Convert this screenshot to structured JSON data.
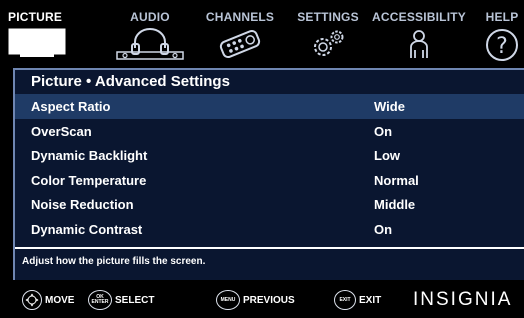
{
  "tabs": [
    {
      "label": "PICTURE",
      "icon": "tv-icon",
      "active": true
    },
    {
      "label": "AUDIO",
      "icon": "headphones-icon",
      "active": false
    },
    {
      "label": "CHANNELS",
      "icon": "remote-icon",
      "active": false
    },
    {
      "label": "SETTINGS",
      "icon": "gears-icon",
      "active": false
    },
    {
      "label": "ACCESSIBILITY",
      "icon": "person-icon",
      "active": false
    },
    {
      "label": "HELP",
      "icon": "help-icon",
      "active": false
    }
  ],
  "panel": {
    "title": "Picture • Advanced Settings",
    "rows": [
      {
        "label": "Aspect Ratio",
        "value": "Wide",
        "selected": true
      },
      {
        "label": "OverScan",
        "value": "On",
        "selected": false
      },
      {
        "label": "Dynamic Backlight",
        "value": "Low",
        "selected": false
      },
      {
        "label": "Color Temperature",
        "value": "Normal",
        "selected": false
      },
      {
        "label": "Noise Reduction",
        "value": "Middle",
        "selected": false
      },
      {
        "label": "Dynamic Contrast",
        "value": "On",
        "selected": false
      }
    ],
    "hint": "Adjust how the picture fills the screen."
  },
  "footer": {
    "keys": [
      {
        "icon": "dpad-icon",
        "key_text": "",
        "label": "MOVE"
      },
      {
        "icon": "ok-enter-icon",
        "key_text": "OK ENTER",
        "label": "SELECT"
      },
      {
        "icon": "menu-icon",
        "key_text": "MENU",
        "label": "PREVIOUS"
      },
      {
        "icon": "exit-icon",
        "key_text": "EXIT",
        "label": "EXIT"
      }
    ],
    "brand": "INSIGNIA"
  },
  "colors": {
    "panel_bg": "#0a1630",
    "selected_row": "#1f3b66",
    "panel_border": "#6f86b2",
    "inactive_tab_text": "#b9c4d6"
  }
}
